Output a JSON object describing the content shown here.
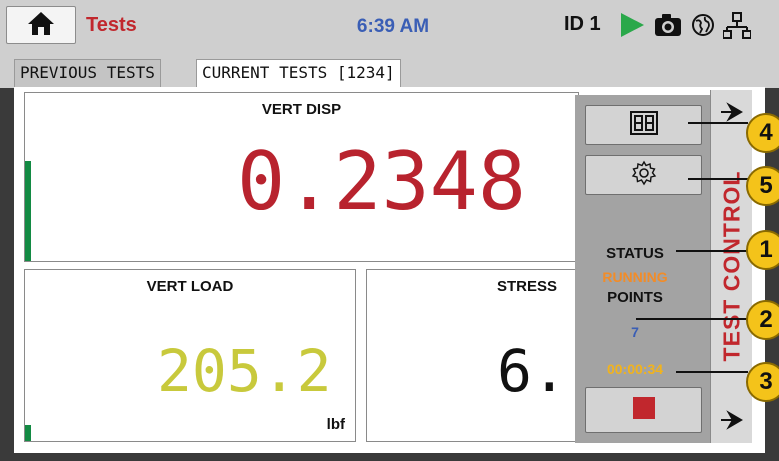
{
  "header": {
    "title": "Tests",
    "time": "6:39 AM",
    "device_id": "ID 1",
    "icons": [
      "home-icon",
      "play-icon",
      "camera-icon",
      "globe-icon",
      "network-icon"
    ]
  },
  "tabs": [
    {
      "label": "PREVIOUS TESTS",
      "active": false
    },
    {
      "label": "CURRENT TESTS [1234]",
      "active": true
    }
  ],
  "panels": {
    "vert_disp": {
      "title": "VERT DISP",
      "value": "0.2348"
    },
    "vert_load": {
      "title": "VERT LOAD",
      "value": "205.2",
      "unit": "lbf"
    },
    "stress": {
      "title": "STRESS",
      "value": "6."
    }
  },
  "control": {
    "status_label": "STATUS",
    "status_value": "RUNNING",
    "points_label": "POINTS",
    "points_value": "7",
    "elapsed": "00:00:34",
    "tab_label": "TEST CONTROL"
  },
  "callouts": [
    "4",
    "5",
    "1",
    "2",
    "3"
  ],
  "colors": {
    "accent_red": "#c1272d",
    "time_blue": "#3a5eb5",
    "status_orange": "#f28c28",
    "timer_yellow": "#f2b31c",
    "load_yellow": "#c8c93c",
    "callout_yellow": "#f4c31a",
    "level_green": "#138a43",
    "play_green": "#2aa84a"
  }
}
